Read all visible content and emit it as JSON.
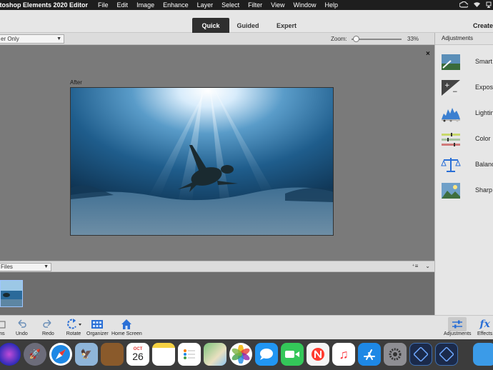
{
  "menubar": {
    "app_title": "otoshop Elements 2020 Editor",
    "items": [
      "File",
      "Edit",
      "Image",
      "Enhance",
      "Layer",
      "Select",
      "Filter",
      "View",
      "Window",
      "Help"
    ],
    "status_icons": [
      "creative-cloud-icon",
      "wifi-icon",
      "airplay-icon"
    ]
  },
  "mode_tabs": {
    "tabs": [
      "Quick",
      "Guided",
      "Expert"
    ],
    "active": "Quick",
    "create_label": "Create"
  },
  "view_bar": {
    "view_select": "er Only",
    "zoom_label": "Zoom:",
    "zoom_value": "33%",
    "zoom_fraction": 0.1
  },
  "canvas": {
    "after_label": "After",
    "close_label": "×",
    "photo_subject": "sea-turtle-underwater-photo"
  },
  "photo_bin": {
    "show_select": "Files",
    "icons": [
      "bin-options-icon",
      "collapse-chevron-icon"
    ]
  },
  "taskbar": {
    "items": [
      {
        "label": "ons",
        "icon": "photo-bin-icon"
      },
      {
        "label": "Undo",
        "icon": "undo-icon"
      },
      {
        "label": "Redo",
        "icon": "redo-icon"
      },
      {
        "label": "Rotate",
        "icon": "rotate-icon"
      },
      {
        "label": "Organizer",
        "icon": "organizer-icon"
      },
      {
        "label": "Home Screen",
        "icon": "home-icon"
      }
    ],
    "right_items": [
      {
        "label": "Adjustments",
        "icon": "adjustments-icon"
      },
      {
        "label": "Effects",
        "icon": "fx-icon"
      }
    ]
  },
  "adjustments_panel": {
    "title": "Adjustments",
    "items": [
      {
        "label": "Smart",
        "icon": "smart-fix-icon"
      },
      {
        "label": "Expos",
        "icon": "exposure-icon"
      },
      {
        "label": "Lightin",
        "icon": "lighting-icon"
      },
      {
        "label": "Color",
        "icon": "color-icon"
      },
      {
        "label": "Balanc",
        "icon": "balance-icon"
      },
      {
        "label": "Sharp",
        "icon": "sharpen-icon"
      }
    ]
  },
  "dock": {
    "calendar_month": "OCT",
    "calendar_day": "26",
    "apps": [
      "siri-icon",
      "launchpad-icon",
      "safari-icon",
      "mail-icon",
      "notes-book-icon",
      "calendar-icon",
      "notes-icon",
      "reminders-icon",
      "maps-icon",
      "photos-icon",
      "messages-icon",
      "facetime-icon",
      "news-icon",
      "music-icon",
      "app-store-icon",
      "system-preferences-icon",
      "photoshop-elements-icon",
      "photoshop-elements-editor-icon",
      "folder-icon"
    ]
  },
  "colors": {
    "menubar_bg": "#1e1e1e",
    "active_tab_bg": "#2f2f2f",
    "canvas_bg": "#7a7a7a",
    "bin_bg": "#6e6e6e",
    "panel_bg": "#e6e6e6",
    "accent": "#2a6fd6"
  }
}
